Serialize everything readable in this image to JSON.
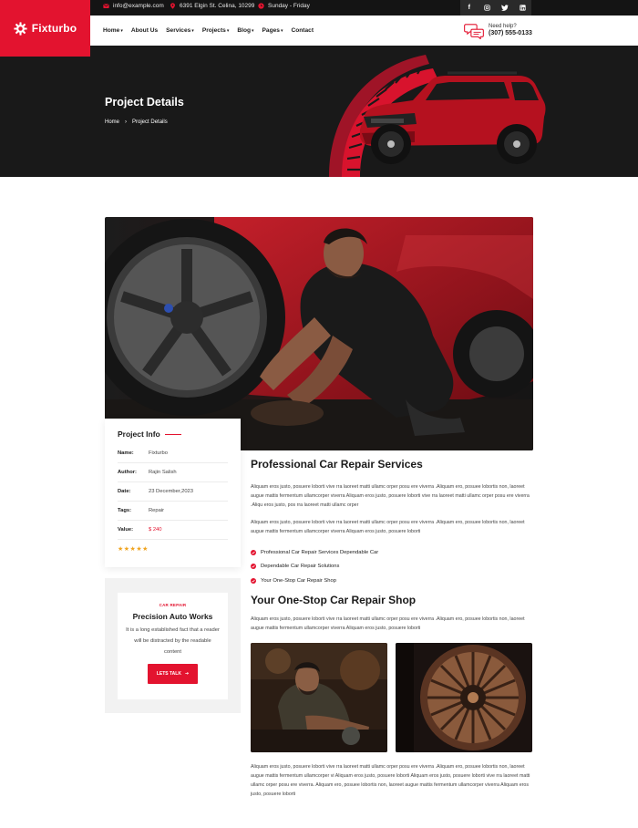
{
  "brand": {
    "name": "Fixturbo",
    "accent": "#e3132f",
    "dark": "#141414"
  },
  "topbar": {
    "email": "info@example.com",
    "address": "6391 Elgin St. Celina, 10299",
    "hours": "Sunday - Friday",
    "socials": [
      "facebook-icon",
      "instagram-icon",
      "twitter-icon",
      "linkedin-icon"
    ]
  },
  "nav": {
    "items": [
      {
        "label": "Home",
        "dropdown": true
      },
      {
        "label": "About Us",
        "dropdown": false
      },
      {
        "label": "Services",
        "dropdown": true
      },
      {
        "label": "Projects",
        "dropdown": true
      },
      {
        "label": "Blog",
        "dropdown": true
      },
      {
        "label": "Pages",
        "dropdown": true
      },
      {
        "label": "Contact",
        "dropdown": false
      }
    ],
    "help_label": "Need help?",
    "help_phone": "(307) 555-0133"
  },
  "hero": {
    "title": "Project Details",
    "breadcrumb": [
      "Home",
      "Project Details"
    ]
  },
  "project_info": {
    "title": "Project Info",
    "rows": [
      {
        "label": "Name:",
        "value": "Fixturbo"
      },
      {
        "label": "Author:",
        "value": "Rajin Salish"
      },
      {
        "label": "Date:",
        "value": "23 December,2023"
      },
      {
        "label": "Tags:",
        "value": "Repair"
      },
      {
        "label": "Value:",
        "value": "$ 240"
      }
    ],
    "rating": 5,
    "stars": "★★★★★"
  },
  "cta": {
    "kicker": "CAR REPAIR",
    "title": "Precision Auto Works",
    "description": "It is a long established fact that a reader will be distracted by the readable content",
    "button": "LETS TALK"
  },
  "content": {
    "heading1": "Professional Car Repair Services",
    "para1": "Aliquam eros justo, posuere loborti vive rra laoreet matti ullamc orper posu ere viverra .Aliquam ero, posuee lobortis non, laoreet augue mattis fermentum ullamcorper viverra Aliquam eros justo, posuere loborti vive rra laoreet matti ullamc orper posu ere viverra .Aliqu eros justo, pos rra laoreet matti ullamc orper",
    "para2": "Aliquam eros justo, posuere loborti vive rra laoreet matti ullamc orper posu ere viverra .Aliquam ero, posuee lobortis non, laoreet augue mattis fermentum ullamcorper viverra Aliquam eros justo, posuere loborti",
    "checks": [
      "Professional Car Repair Services Dependable Car",
      "Dependable Car Repair Solutions",
      "Your One-Stop Car Repair Shop"
    ],
    "heading2": "Your One-Stop Car Repair Shop",
    "para3": "Aliquam eros justo, posuere loborti vive rra laoreet matti ullamc orper posu ere viverra .Aliquam ero, posuee lobortis non, laoreet augue mattis fermentum ullamcorper viverra Aliquam eros justo, posuere loborti",
    "para4": "Aliquam eros justo, posuere loborti vive rra laoreet matti ullamc orper posu ere viverra .Aliquam ero, posuee lobortis non, laoreet augue mattis fermentum ullamcorper vi Aliquam eros justo, posuere loborti Aliquam eros justo, posuere loborti vive rra laoreet matti ullamc orper posu ere viverra. Aliquam ero, posuee lobortis non, laoreet augue mattis fermentum ullamcorper viverra Aliquam eros justo, posuere loborti"
  }
}
